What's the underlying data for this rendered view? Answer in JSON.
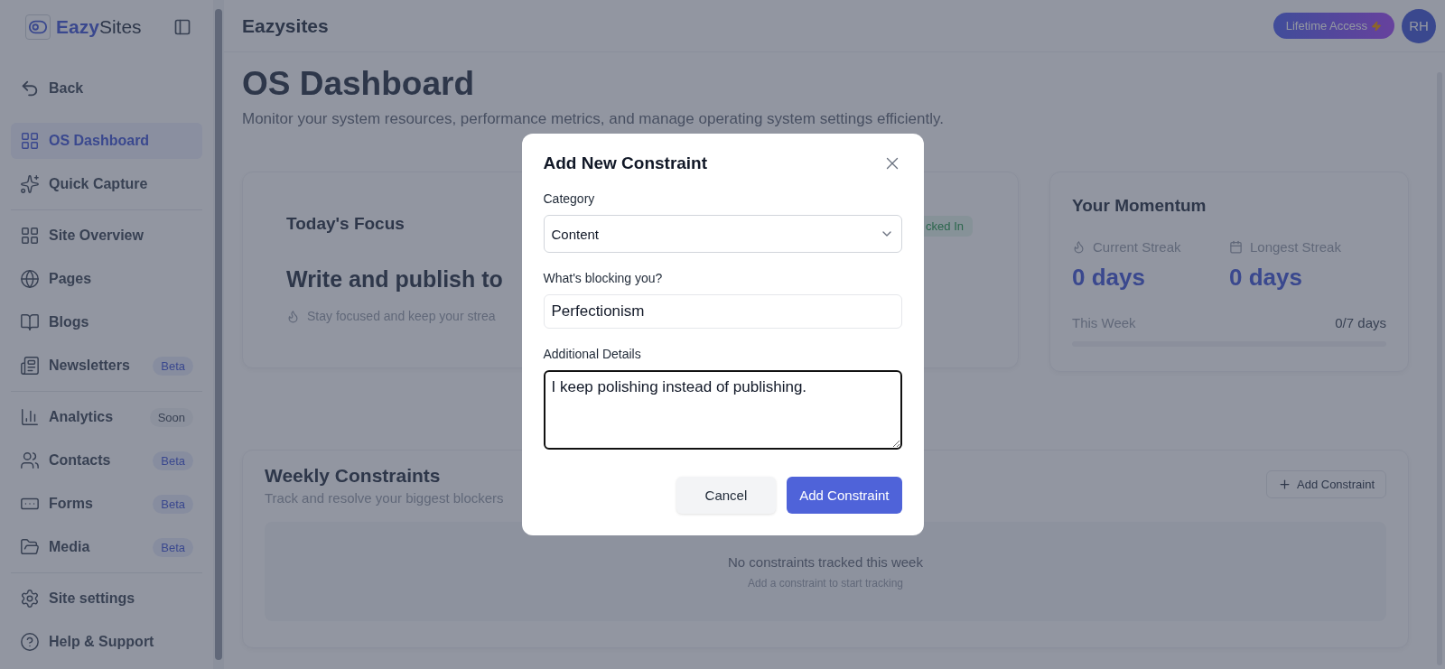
{
  "sidebar": {
    "brand": {
      "prefix": "Eazy",
      "suffix": "Sites"
    },
    "back": "Back",
    "groups": [
      [
        {
          "label": "OS Dashboard",
          "selected": true
        },
        {
          "label": "Quick Capture",
          "selected": false
        }
      ],
      [
        {
          "label": "Site Overview",
          "selected": false
        },
        {
          "label": "Pages",
          "selected": false
        },
        {
          "label": "Blogs",
          "selected": false
        },
        {
          "label": "Newsletters",
          "selected": false,
          "badge": {
            "text": "Beta",
            "kind": "beta"
          }
        }
      ],
      [
        {
          "label": "Analytics",
          "selected": false,
          "badge": {
            "text": "Soon",
            "kind": "soon"
          }
        },
        {
          "label": "Contacts",
          "selected": false,
          "badge": {
            "text": "Beta",
            "kind": "beta"
          }
        },
        {
          "label": "Forms",
          "selected": false,
          "badge": {
            "text": "Beta",
            "kind": "beta"
          }
        },
        {
          "label": "Media",
          "selected": false,
          "badge": {
            "text": "Beta",
            "kind": "beta"
          }
        }
      ],
      [
        {
          "label": "Site settings",
          "selected": false
        },
        {
          "label": "Help & Support",
          "selected": false
        }
      ]
    ]
  },
  "header": {
    "title": "Eazysites",
    "plan": "Lifetime Access",
    "avatar": "RH"
  },
  "page": {
    "title": "OS Dashboard",
    "subtitle": "Monitor your system resources, performance metrics, and manage operating system settings efficiently."
  },
  "focus": {
    "title": "Today's Focus",
    "badge": "cked In",
    "goal": "Write and publish to",
    "hint": "Stay focused and keep your strea"
  },
  "momentum": {
    "title": "Your Momentum",
    "stats": [
      {
        "label": "Current Streak",
        "value": "0 days"
      },
      {
        "label": "Longest Streak",
        "value": "0 days"
      }
    ],
    "week_label": "This Week",
    "week_value": "0/7 days",
    "level": 0
  },
  "constraints": {
    "title": "Weekly Constraints",
    "subtitle": "Track and resolve your biggest blockers",
    "add": "Add Constraint",
    "empty_title": "No constraints tracked this week",
    "empty_hint": "Add a constraint to start tracking"
  },
  "modal": {
    "title": "Add New Constraint",
    "category_label": "Category",
    "category": "Content",
    "blocker_label": "What's blocking you?",
    "blocker": "Perfectionism",
    "details_label": "Additional Details",
    "details": "I keep polishing instead of publishing.",
    "cancel": "Cancel",
    "submit": "Add Constraint"
  }
}
